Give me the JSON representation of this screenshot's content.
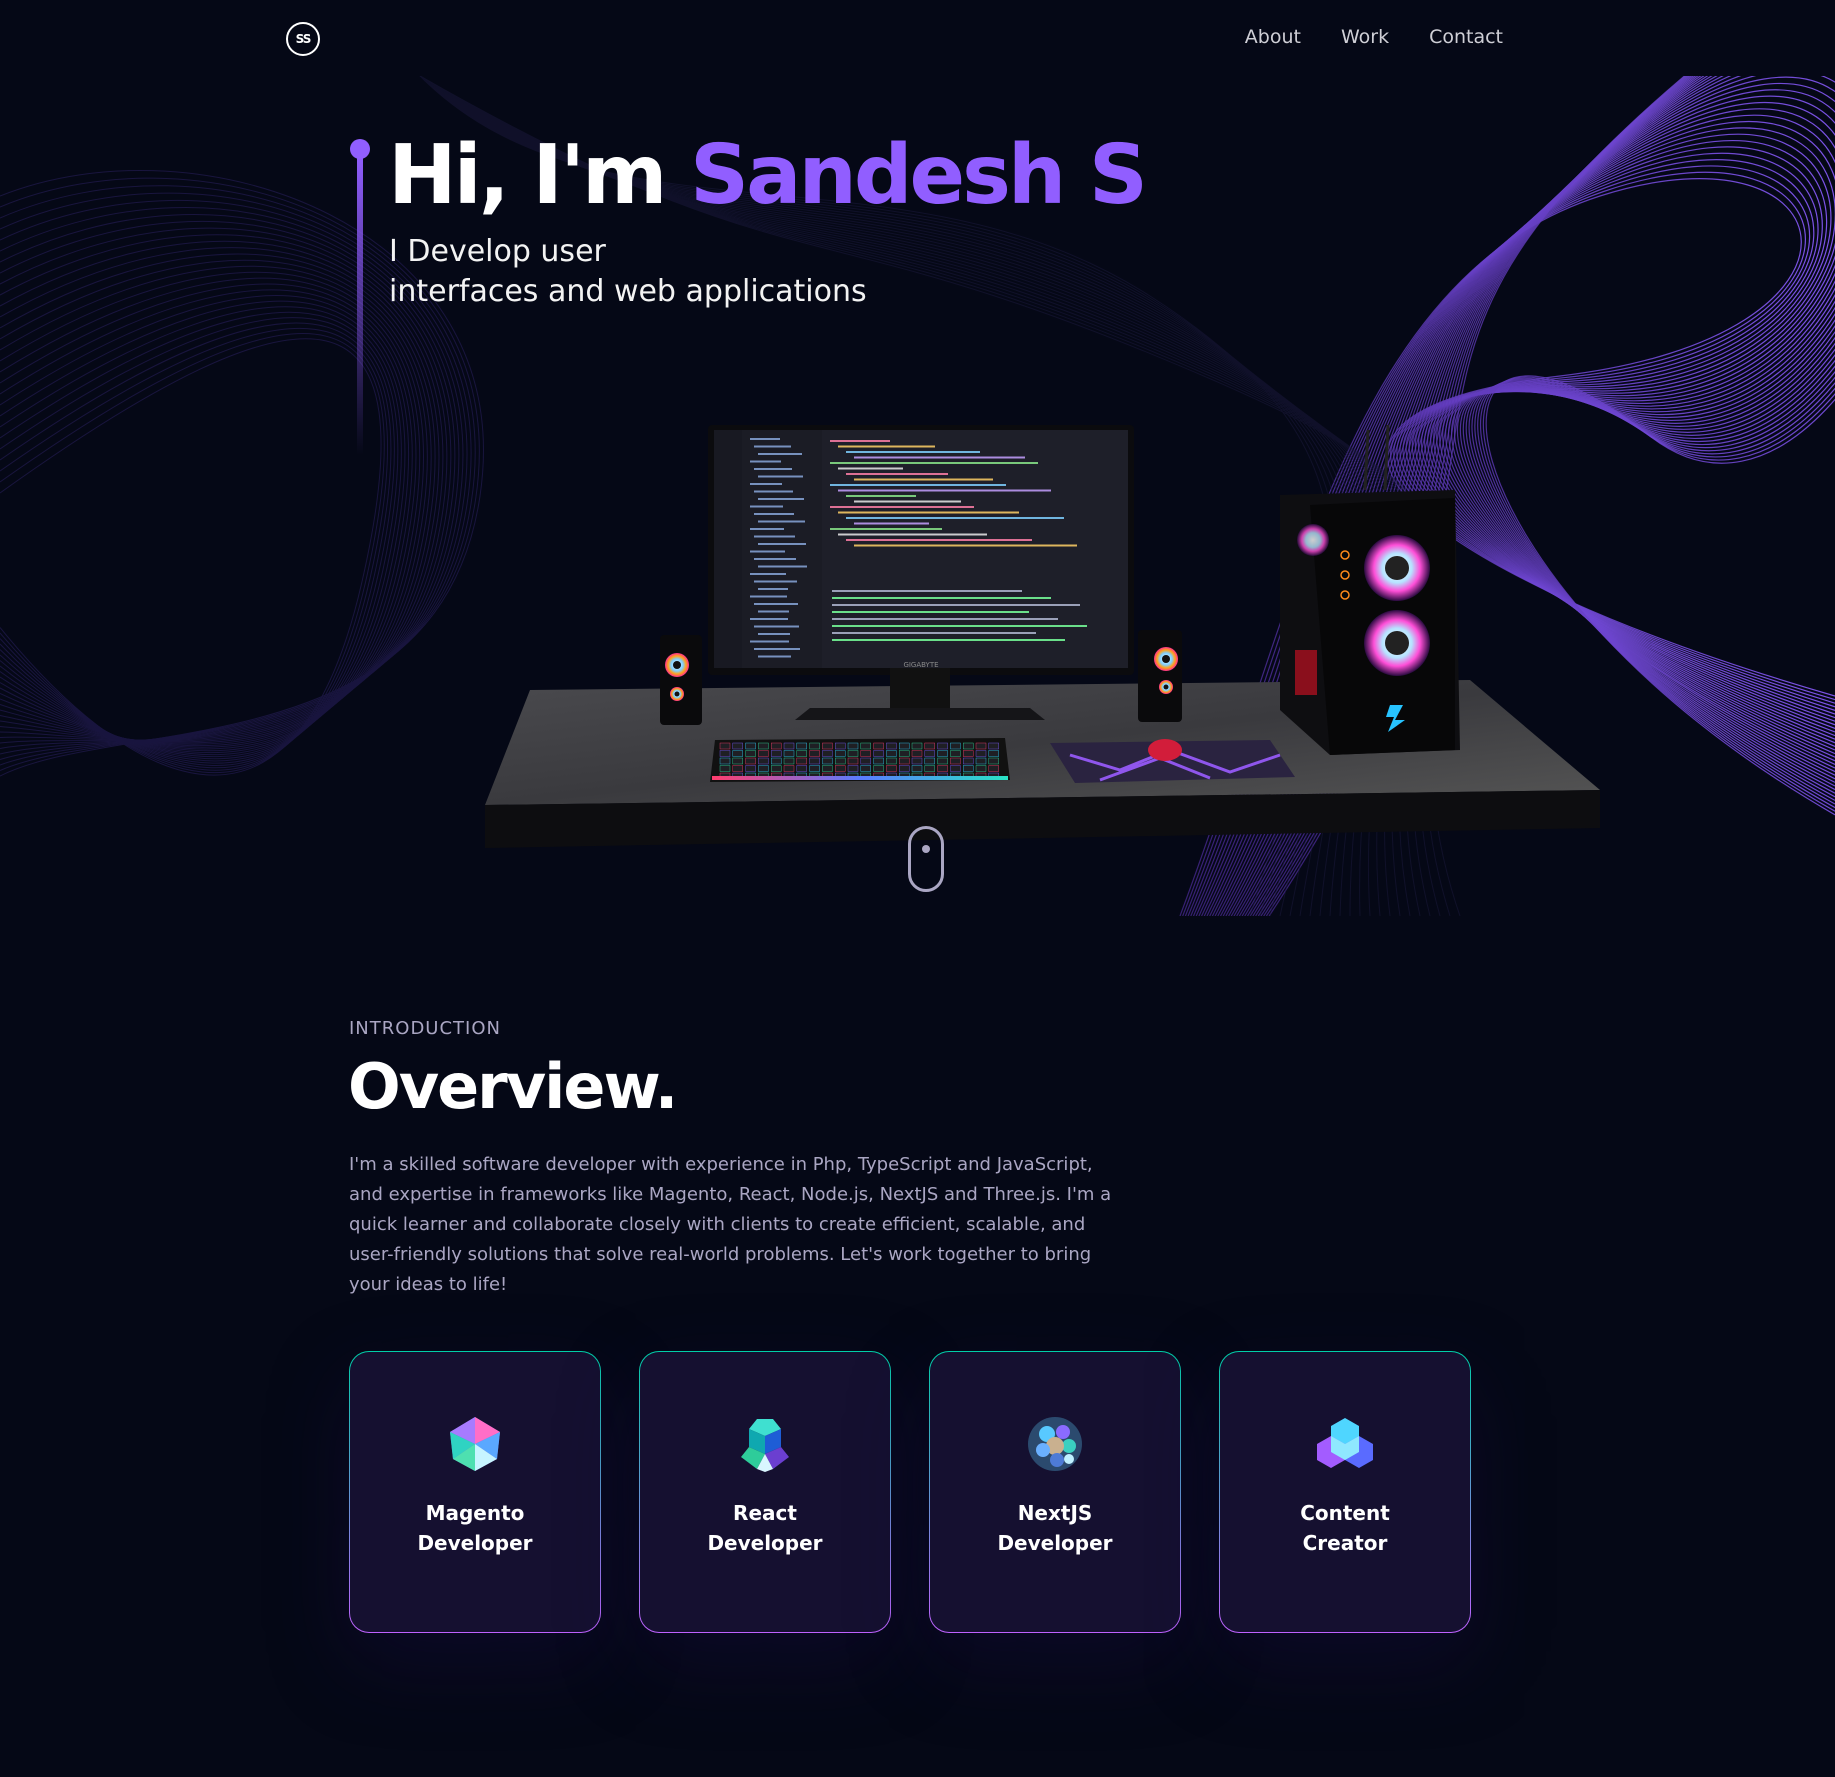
{
  "nav": {
    "logo_text": "SS",
    "links": [
      {
        "label": "About"
      },
      {
        "label": "Work"
      },
      {
        "label": "Contact"
      }
    ]
  },
  "hero": {
    "greeting": "Hi, I'm ",
    "name": "Sandesh S",
    "subtitle_line1": "I Develop user",
    "subtitle_line2": "interfaces and web applications",
    "monitor_brand": "GIGABYTE"
  },
  "overview": {
    "label": "INTRODUCTION",
    "title": "Overview.",
    "text": "I'm a skilled software developer with experience in Php, TypeScript and JavaScript, and expertise in frameworks like Magento, React, Node.js, NextJS and Three.js. I'm a quick learner and collaborate closely with clients to create efficient, scalable, and user-friendly solutions that solve real-world problems. Let's work together to bring your ideas to life!"
  },
  "services": [
    {
      "line1": "Magento",
      "line2": "Developer",
      "icon": "crystal-icon"
    },
    {
      "line1": "React",
      "line2": "Developer",
      "icon": "cube-cluster-icon"
    },
    {
      "line1": "NextJS",
      "line2": "Developer",
      "icon": "sphere-icon"
    },
    {
      "line1": "Content",
      "line2": "Creator",
      "icon": "hexagon-cluster-icon"
    }
  ],
  "colors": {
    "background": "#050816",
    "accent": "#915eff",
    "secondary_text": "#aaa6c3",
    "card_bg": "#151030",
    "card_border_top": "#00cea8",
    "card_border_bottom": "#bf61ff"
  }
}
